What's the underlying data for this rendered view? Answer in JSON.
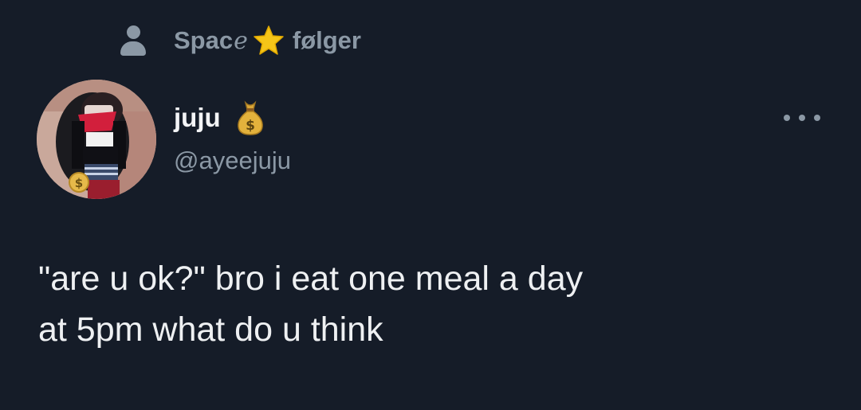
{
  "context": {
    "icon": "person-icon",
    "space_text": "Spac",
    "space_script_letter": "e",
    "star_icon": "star-icon",
    "follows_text": "følger"
  },
  "author": {
    "display_name": "juju",
    "badge_icon": "money-bag-icon",
    "handle": "@ayeejuju",
    "avatar_badge_icon": "dollar-coin-icon"
  },
  "tweet": {
    "text": "\"are u ok?\" bro i eat one meal a day\nat 5pm what do u think"
  },
  "more_icon": "more-dots-icon",
  "colors": {
    "background": "#151c28",
    "secondary_text": "#8b98a5",
    "primary_text": "#e7e9ea",
    "star": "#f5c518"
  }
}
